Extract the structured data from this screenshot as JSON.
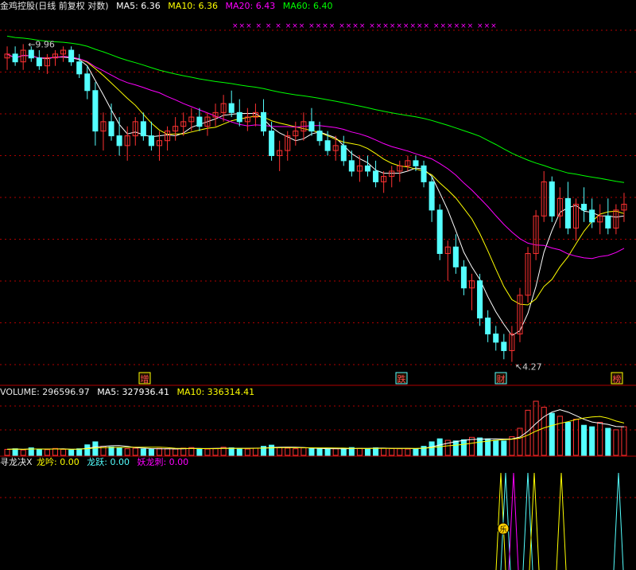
{
  "header": {
    "title": "金鸡控股(日线 前复权 对数)",
    "ma5": "MA5: 6.36",
    "ma10": "MA10: 6.36",
    "ma20": "MA20: 6.43",
    "ma60": "MA60: 6.40"
  },
  "price_panel": {
    "high_label": "9.96",
    "low_label": "4.27",
    "event_tags": [
      "增",
      "跌",
      "财",
      "榜"
    ],
    "signal_marks": "×××  ×    ×    ×  ×××  ××××  ××××  ×××××××××   ××××××  ×××"
  },
  "volume_panel": {
    "volume": "VOLUME: 296596.97",
    "ma5": "MA5: 327936.41",
    "ma10": "MA10: 336314.41"
  },
  "indicator_panel": {
    "name": "寻龙决X",
    "longyin": "龙吟: 0.00",
    "longyue": "龙跃: 0.00",
    "yaolongci": "妖龙刺: 0.00",
    "marker": "乐"
  },
  "colors": {
    "up": "#ff3232",
    "down": "#54ffff",
    "ma5": "#ffffff",
    "ma10": "#ffff00",
    "ma20": "#ff00ff",
    "ma60": "#00ff00",
    "grid": "#b00000",
    "yellow_text": "#ffff00"
  },
  "chart_data": {
    "type": "candlestick",
    "price_range": [
      4.27,
      9.96
    ],
    "scale": "log",
    "candles": [
      [
        9.6,
        9.9,
        9.3,
        9.7
      ],
      [
        9.7,
        9.9,
        9.4,
        9.5
      ],
      [
        9.5,
        9.96,
        9.3,
        9.8
      ],
      [
        9.8,
        9.9,
        9.5,
        9.6
      ],
      [
        9.6,
        9.8,
        9.3,
        9.4
      ],
      [
        9.4,
        9.7,
        9.2,
        9.6
      ],
      [
        9.6,
        9.8,
        9.4,
        9.7
      ],
      [
        9.7,
        9.9,
        9.5,
        9.8
      ],
      [
        9.8,
        9.9,
        9.4,
        9.5
      ],
      [
        9.5,
        9.7,
        9.1,
        9.2
      ],
      [
        9.2,
        9.4,
        8.6,
        8.8
      ],
      [
        8.8,
        9.0,
        7.6,
        7.9
      ],
      [
        7.9,
        8.3,
        7.5,
        8.1
      ],
      [
        8.1,
        8.5,
        7.7,
        7.8
      ],
      [
        7.8,
        8.2,
        7.4,
        7.6
      ],
      [
        7.6,
        8.0,
        7.3,
        7.8
      ],
      [
        7.8,
        8.2,
        7.6,
        8.1
      ],
      [
        8.1,
        8.3,
        7.7,
        7.8
      ],
      [
        7.8,
        8.1,
        7.5,
        7.6
      ],
      [
        7.6,
        7.9,
        7.3,
        7.7
      ],
      [
        7.7,
        8.0,
        7.5,
        7.9
      ],
      [
        7.9,
        8.2,
        7.7,
        8.0
      ],
      [
        8.0,
        8.3,
        7.8,
        8.1
      ],
      [
        8.1,
        8.4,
        7.9,
        8.2
      ],
      [
        8.2,
        8.4,
        7.9,
        8.0
      ],
      [
        8.0,
        8.3,
        7.8,
        8.2
      ],
      [
        8.2,
        8.5,
        8.0,
        8.3
      ],
      [
        8.3,
        8.7,
        8.1,
        8.5
      ],
      [
        8.5,
        8.8,
        8.2,
        8.3
      ],
      [
        8.3,
        8.6,
        8.0,
        8.1
      ],
      [
        8.1,
        8.4,
        7.9,
        8.2
      ],
      [
        8.2,
        8.5,
        8.0,
        8.3
      ],
      [
        8.3,
        8.6,
        7.8,
        7.9
      ],
      [
        7.9,
        8.1,
        7.3,
        7.4
      ],
      [
        7.4,
        7.7,
        7.1,
        7.5
      ],
      [
        7.5,
        7.9,
        7.3,
        7.8
      ],
      [
        7.8,
        8.1,
        7.6,
        7.9
      ],
      [
        7.9,
        8.3,
        7.7,
        8.1
      ],
      [
        8.1,
        8.4,
        7.8,
        7.9
      ],
      [
        7.9,
        8.1,
        7.6,
        7.7
      ],
      [
        7.7,
        7.9,
        7.4,
        7.5
      ],
      [
        7.5,
        7.8,
        7.3,
        7.6
      ],
      [
        7.6,
        7.8,
        7.2,
        7.3
      ],
      [
        7.3,
        7.5,
        7.0,
        7.1
      ],
      [
        7.1,
        7.4,
        6.9,
        7.2
      ],
      [
        7.2,
        7.4,
        7.0,
        7.1
      ],
      [
        7.1,
        7.3,
        6.8,
        6.9
      ],
      [
        6.9,
        7.1,
        6.7,
        7.0
      ],
      [
        7.0,
        7.2,
        6.8,
        7.1
      ],
      [
        7.1,
        7.3,
        6.9,
        7.2
      ],
      [
        7.2,
        7.4,
        7.1,
        7.3
      ],
      [
        7.3,
        7.4,
        7.1,
        7.2
      ],
      [
        7.2,
        7.3,
        6.8,
        6.9
      ],
      [
        6.9,
        7.0,
        6.2,
        6.4
      ],
      [
        6.4,
        6.5,
        5.6,
        5.7
      ],
      [
        5.7,
        5.9,
        5.3,
        5.8
      ],
      [
        5.8,
        6.0,
        5.4,
        5.5
      ],
      [
        5.5,
        5.6,
        5.1,
        5.2
      ],
      [
        5.2,
        5.4,
        4.9,
        5.3
      ],
      [
        5.3,
        5.4,
        4.7,
        4.8
      ],
      [
        4.8,
        4.9,
        4.5,
        4.6
      ],
      [
        4.6,
        4.7,
        4.4,
        4.5
      ],
      [
        4.5,
        4.6,
        4.3,
        4.4
      ],
      [
        4.4,
        4.7,
        4.27,
        4.6
      ],
      [
        4.6,
        5.2,
        4.5,
        5.1
      ],
      [
        5.1,
        5.8,
        5.0,
        5.7
      ],
      [
        5.7,
        6.4,
        5.6,
        6.3
      ],
      [
        6.3,
        7.1,
        6.2,
        6.9
      ],
      [
        6.9,
        7.0,
        6.2,
        6.3
      ],
      [
        6.3,
        6.8,
        6.1,
        6.6
      ],
      [
        6.6,
        6.9,
        6.0,
        6.1
      ],
      [
        6.1,
        6.6,
        5.9,
        6.5
      ],
      [
        6.5,
        6.8,
        6.2,
        6.4
      ],
      [
        6.4,
        6.6,
        6.1,
        6.2
      ],
      [
        6.2,
        6.5,
        6.0,
        6.3
      ],
      [
        6.3,
        6.6,
        6.0,
        6.1
      ],
      [
        6.1,
        6.5,
        6.0,
        6.4
      ],
      [
        6.4,
        6.7,
        6.2,
        6.5
      ]
    ],
    "series_names": [
      "MA5",
      "MA10",
      "MA20",
      "MA60"
    ],
    "volume": [
      20,
      22,
      18,
      25,
      21,
      19,
      23,
      20,
      18,
      22,
      35,
      45,
      30,
      28,
      25,
      22,
      24,
      21,
      20,
      23,
      22,
      21,
      24,
      26,
      22,
      21,
      23,
      27,
      25,
      22,
      21,
      24,
      30,
      34,
      26,
      24,
      22,
      25,
      23,
      21,
      20,
      22,
      24,
      26,
      23,
      22,
      25,
      24,
      23,
      22,
      21,
      22,
      30,
      45,
      55,
      50,
      48,
      52,
      60,
      58,
      55,
      50,
      48,
      62,
      90,
      150,
      180,
      160,
      140,
      130,
      110,
      120,
      100,
      95,
      110,
      90,
      85,
      95
    ]
  }
}
